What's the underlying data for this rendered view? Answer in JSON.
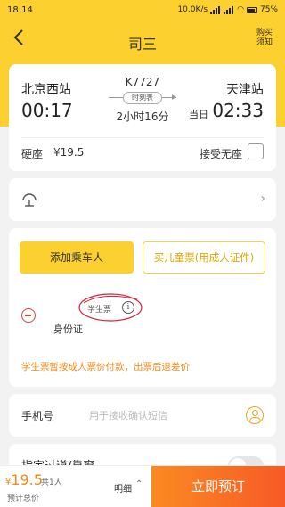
{
  "status_bar": {
    "time": "18:14",
    "network_speed": "10.0K/s",
    "battery": "75%"
  },
  "header": {
    "title": "司三",
    "notice_label": "购买须知",
    "back_icon": "chevron-left-icon"
  },
  "train": {
    "from_station": "北京西站",
    "departure_time": "00:17",
    "train_number": "K7727",
    "timetable_label": "时刻表",
    "duration": "2小时16分",
    "to_station": "天津站",
    "arrival_day": "当日",
    "arrival_time": "02:33",
    "seat_type": "硬座",
    "price": "¥19.5",
    "accept_standing_label": "接受无座",
    "accept_standing_checked": false
  },
  "insurance": {
    "icon": "umbrella-icon"
  },
  "passengers": {
    "add_passenger_label": "添加乘车人",
    "add_child_label": "买儿童票(用成人证件)",
    "list": [
      {
        "ticket_type": "学生票",
        "id_type": "身份证"
      }
    ],
    "notice": "学生票暂按成人票价付款，出票后退差价"
  },
  "phone": {
    "label": "手机号",
    "placeholder": "用于接收确认短信",
    "value": ""
  },
  "seat_preference": {
    "label": "指定过道/靠窗"
  },
  "bottom_bar": {
    "price_symbol": "¥",
    "price": "19.5",
    "passenger_count": "共1人",
    "total_label": "预计总价",
    "detail_label": "明细",
    "detail_chevron": "⌃",
    "book_label": "立即预订"
  },
  "colors": {
    "brand_yellow": "#fcd02e",
    "accent_orange": "#f08a18",
    "book_gradient_start": "#fb8a22",
    "book_gradient_end": "#f65a26",
    "remove_red": "#e0403a"
  }
}
